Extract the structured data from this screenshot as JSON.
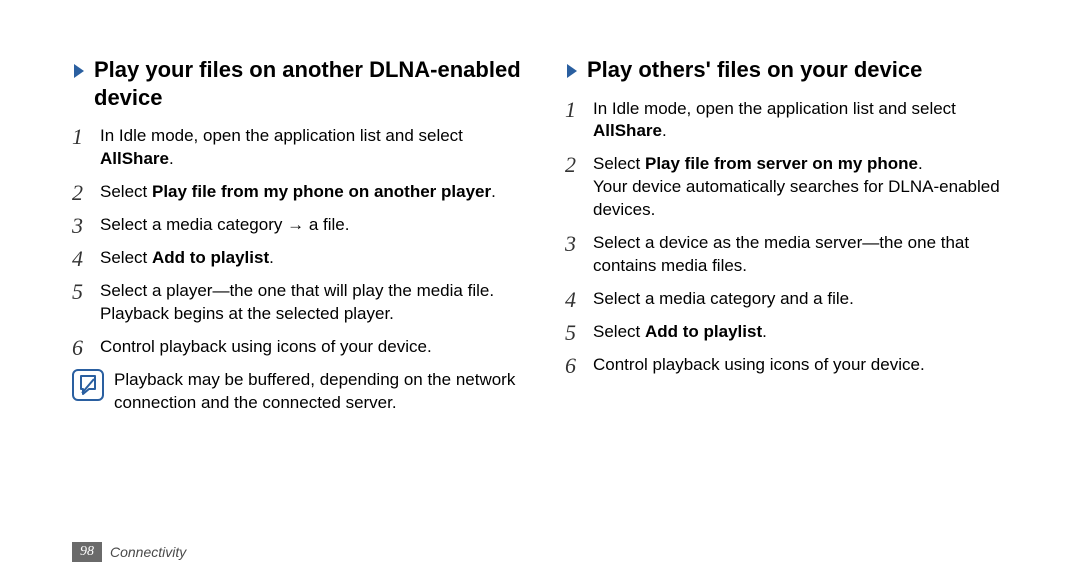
{
  "left": {
    "heading": "Play your files on another DLNA-enabled device",
    "steps": [
      {
        "n": "1",
        "pre": "In Idle mode, open the application list and select ",
        "bold": "AllShare",
        "post": "."
      },
      {
        "n": "2",
        "pre": "Select ",
        "bold": "Play file from my phone on another player",
        "post": "."
      },
      {
        "n": "3",
        "pre": "Select a media category → a file.",
        "bold": "",
        "post": ""
      },
      {
        "n": "4",
        "pre": "Select ",
        "bold": "Add to playlist",
        "post": "."
      },
      {
        "n": "5",
        "pre": "Select a player—the one that will play the media file. Playback begins at the selected player.",
        "bold": "",
        "post": ""
      },
      {
        "n": "6",
        "pre": "Control playback using icons of your device.",
        "bold": "",
        "post": ""
      }
    ],
    "note": "Playback may be buffered, depending on the network connection and the connected server."
  },
  "right": {
    "heading": "Play others' files on your device",
    "steps": [
      {
        "n": "1",
        "pre": "In Idle mode, open the application list and select ",
        "bold": "AllShare",
        "post": "."
      },
      {
        "n": "2",
        "pre": "Select ",
        "bold": "Play file from server on my phone",
        "post": ".",
        "extra": "Your device automatically searches for DLNA-enabled devices."
      },
      {
        "n": "3",
        "pre": "Select a device as the media server—the one that contains media files.",
        "bold": "",
        "post": ""
      },
      {
        "n": "4",
        "pre": "Select a media category and a file.",
        "bold": "",
        "post": ""
      },
      {
        "n": "5",
        "pre": "Select ",
        "bold": "Add to playlist",
        "post": "."
      },
      {
        "n": "6",
        "pre": "Control playback using icons of your device.",
        "bold": "",
        "post": ""
      }
    ]
  },
  "footer": {
    "page": "98",
    "section": "Connectivity"
  },
  "icons": {
    "chevron": "chevron-right-icon",
    "note": "note-icon"
  }
}
